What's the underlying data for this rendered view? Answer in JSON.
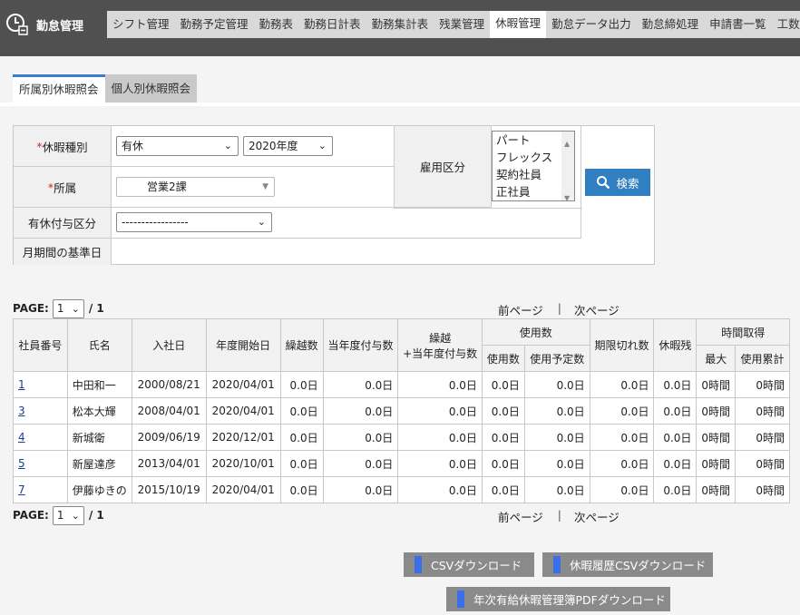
{
  "app": {
    "title": "勤怠管理"
  },
  "nav": [
    "シフト管理",
    "勤務予定管理",
    "勤務表",
    "勤務日計表",
    "勤務集計表",
    "残業管理",
    "休暇管理",
    "勤怠データ出力",
    "勤怠締処理",
    "申請書一覧",
    "工数管理"
  ],
  "nav_active": "休暇管理",
  "subtabs": [
    "所属別休暇照会",
    "個人別休暇照会"
  ],
  "form": {
    "leave_type_label": "休暇種別",
    "leave_type_value": "有休",
    "year_value": "2020年度",
    "dept_label": "所属",
    "dept_value": "営業2課",
    "grant_label": "有休付与区分",
    "grant_value": "-----------------",
    "month_base_label": "月期間の基準日",
    "employment_label": "雇用区分",
    "employment_options": [
      "パート",
      "フレックス",
      "契約社員",
      "正社員"
    ],
    "required_mark": "*",
    "search_label": "検索"
  },
  "pager": {
    "label": "PAGE:",
    "current": "1",
    "total": "/ 1",
    "prev": "前ページ",
    "sep": "|",
    "next": "次ページ"
  },
  "table": {
    "headers": {
      "emp_no": "社員番号",
      "name": "氏名",
      "join_date": "入社日",
      "fy_start": "年度開始日",
      "carryover": "繰越数",
      "grant_this_year": "当年度付与数",
      "carry_plus_grant_1": "繰越",
      "carry_plus_grant_2": "+当年度付与数",
      "usage": "使用数",
      "used": "使用数",
      "planned": "使用予定数",
      "expired": "期限切れ数",
      "remaining": "休暇残",
      "hourly": "時間取得",
      "max": "最大",
      "cumulative": "使用累計"
    },
    "rows": [
      {
        "no": "1",
        "name": "中田和一",
        "join": "2000/08/21",
        "fy": "2020/04/01",
        "carry": "0.0日",
        "grant": "0.0日",
        "total": "0.0日",
        "used": "0.0日",
        "planned": "0.0日",
        "expired": "0.0日",
        "remain": "0.0日",
        "max": "0時間",
        "cum": "0時間"
      },
      {
        "no": "3",
        "name": "松本大輝",
        "join": "2008/04/01",
        "fy": "2020/04/01",
        "carry": "0.0日",
        "grant": "0.0日",
        "total": "0.0日",
        "used": "0.0日",
        "planned": "0.0日",
        "expired": "0.0日",
        "remain": "0.0日",
        "max": "0時間",
        "cum": "0時間"
      },
      {
        "no": "4",
        "name": "新城衛",
        "join": "2009/06/19",
        "fy": "2020/12/01",
        "carry": "0.0日",
        "grant": "0.0日",
        "total": "0.0日",
        "used": "0.0日",
        "planned": "0.0日",
        "expired": "0.0日",
        "remain": "0.0日",
        "max": "0時間",
        "cum": "0時間"
      },
      {
        "no": "5",
        "name": "新屋達彦",
        "join": "2013/04/01",
        "fy": "2020/10/01",
        "carry": "0.0日",
        "grant": "0.0日",
        "total": "0.0日",
        "used": "0.0日",
        "planned": "0.0日",
        "expired": "0.0日",
        "remain": "0.0日",
        "max": "0時間",
        "cum": "0時間"
      },
      {
        "no": "7",
        "name": "伊藤ゆきの",
        "join": "2015/10/19",
        "fy": "2020/04/01",
        "carry": "0.0日",
        "grant": "0.0日",
        "total": "0.0日",
        "used": "0.0日",
        "planned": "0.0日",
        "expired": "0.0日",
        "remain": "0.0日",
        "max": "0時間",
        "cum": "0時間"
      }
    ]
  },
  "downloads": {
    "csv": "CSVダウンロード",
    "history_csv": "休暇履歴CSVダウンロード",
    "annual_pdf": "年次有給休暇管理簿PDFダウンロード"
  }
}
